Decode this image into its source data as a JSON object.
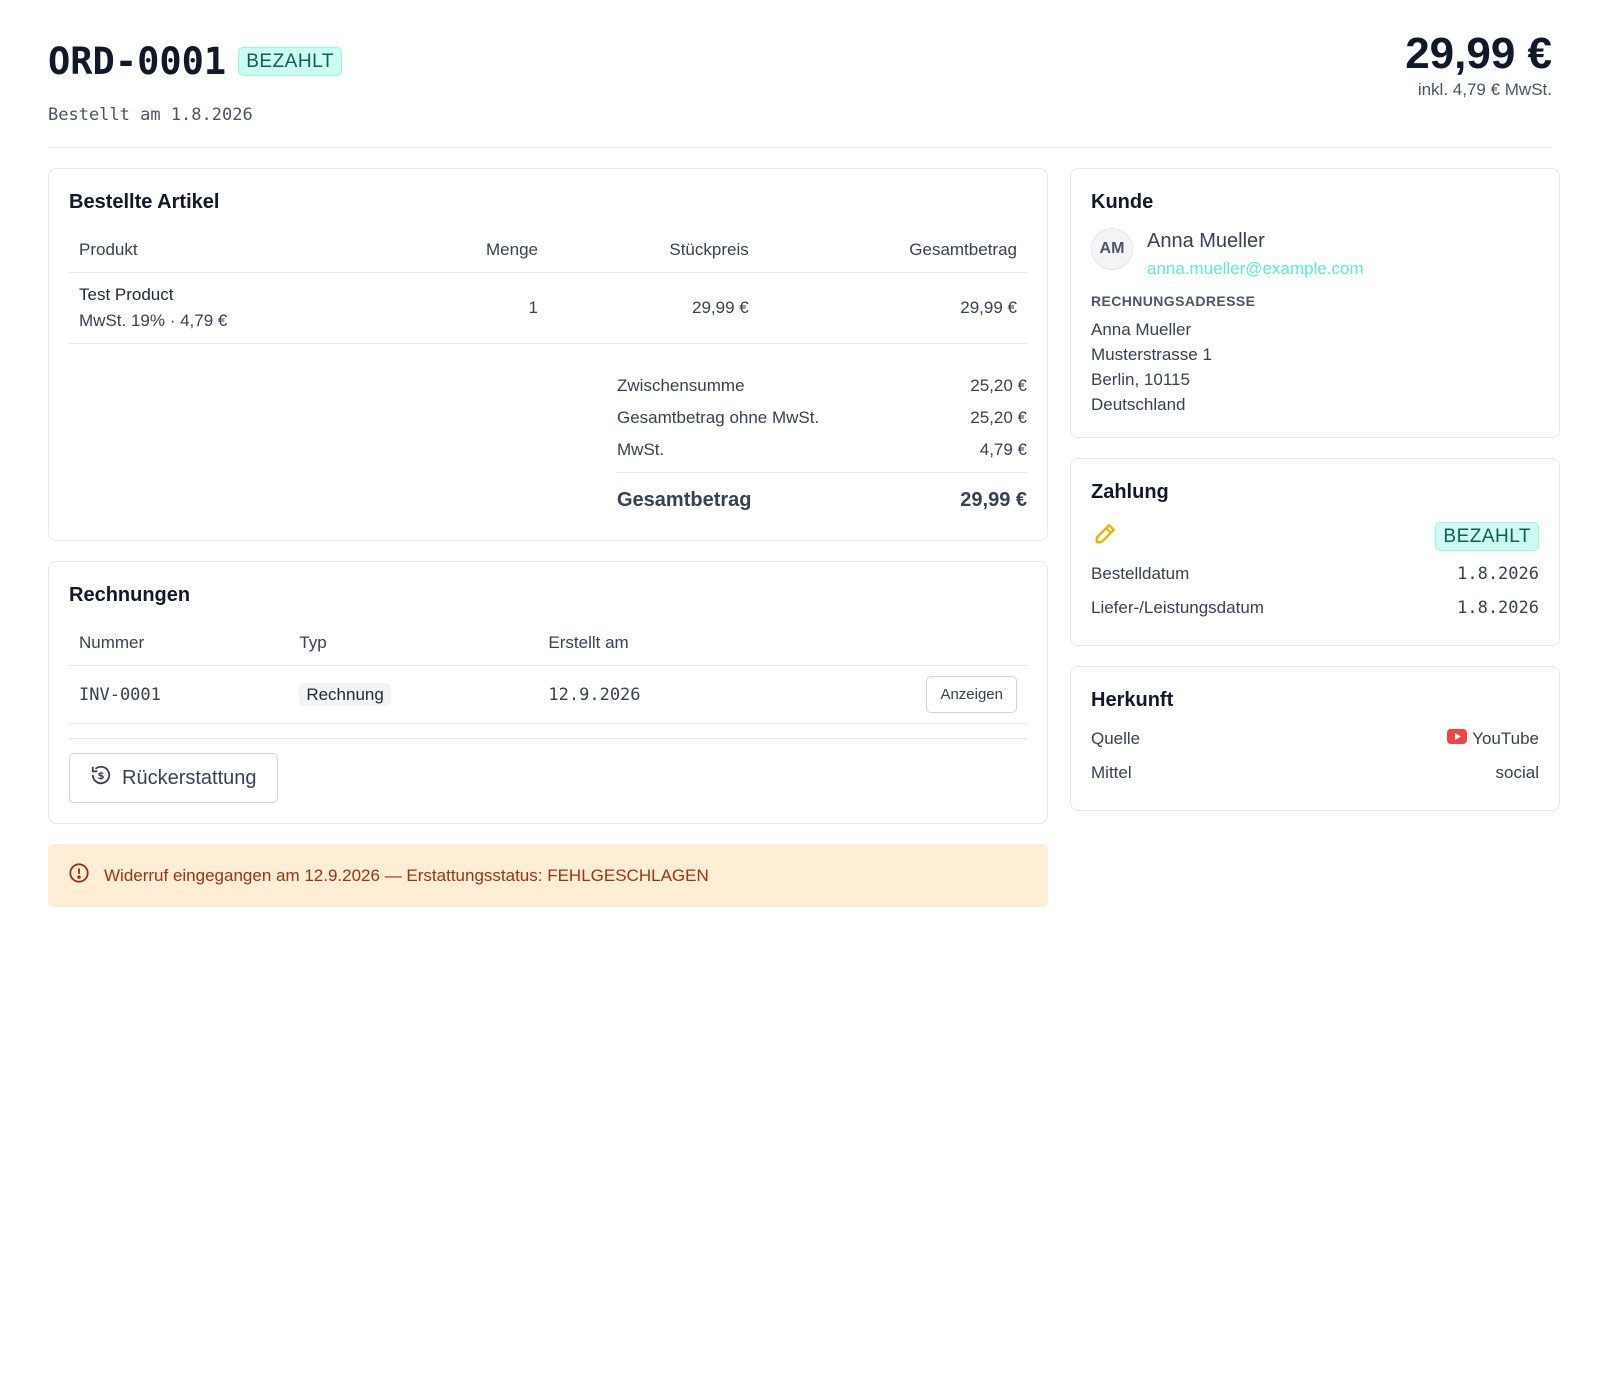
{
  "header": {
    "order_id": "ORD-0001",
    "status_badge": "BEZAHLT",
    "ordered_at": "Bestellt am 1.8.2026",
    "total": "29,99 €",
    "total_vat_note": "inkl. 4,79 € MwSt."
  },
  "items_card": {
    "title": "Bestellte Artikel",
    "columns": [
      "Produkt",
      "Menge",
      "Stückpreis",
      "Gesamtbetrag"
    ],
    "rows": [
      {
        "product": "Test Product",
        "vat_note": "MwSt. 19% · 4,79 €",
        "qty": "1",
        "unit_price": "29,99 €",
        "total": "29,99 €"
      }
    ],
    "totals": {
      "subtotal_label": "Zwischensumme",
      "subtotal": "25,20 €",
      "net_label": "Gesamtbetrag ohne MwSt.",
      "net": "25,20 €",
      "vat_label": "MwSt.",
      "vat": "4,79 €",
      "grand_label": "Gesamtbetrag",
      "grand": "29,99 €"
    }
  },
  "invoices_card": {
    "title": "Rechnungen",
    "columns": [
      "Nummer",
      "Typ",
      "Erstellt am"
    ],
    "rows": [
      {
        "number": "INV-0001",
        "type": "Rechnung",
        "created": "12.9.2026",
        "action": "Anzeigen"
      }
    ],
    "refund_button": "Rückerstattung"
  },
  "alert": {
    "text": "Widerruf eingegangen am 12.9.2026 — Erstattungsstatus: FEHLGESCHLAGEN"
  },
  "customer_card": {
    "title": "Kunde",
    "initials": "AM",
    "name": "Anna Mueller",
    "email": "anna.mueller@example.com",
    "billing_label": "RECHNUNGSADRESSE",
    "address": [
      "Anna Mueller",
      "Musterstrasse 1",
      "Berlin, 10115",
      "Deutschland"
    ]
  },
  "payment_card": {
    "title": "Zahlung",
    "method_icon": "pencil-icon",
    "status_badge": "BEZAHLT",
    "order_date_label": "Bestelldatum",
    "order_date": "1.8.2026",
    "service_date_label": "Liefer-/Leistungsdatum",
    "service_date": "1.8.2026"
  },
  "origin_card": {
    "title": "Herkunft",
    "source_label": "Quelle",
    "source": "YouTube",
    "source_icon": "youtube-icon",
    "medium_label": "Mittel",
    "medium": "social"
  },
  "colors": {
    "badge_bg": "#ccfbf1",
    "badge_text": "#115e59",
    "accent_email": "#5eead4",
    "alert_bg": "#ffedd5",
    "alert_text": "#9a3412",
    "youtube_red": "#ef4444",
    "pencil_yellow": "#eab308"
  }
}
